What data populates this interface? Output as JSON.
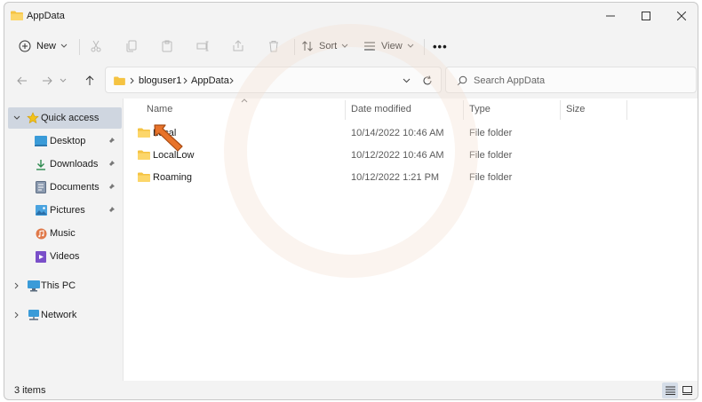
{
  "window": {
    "title": "AppData",
    "controls": {
      "minimize": "—",
      "maximize": "☐",
      "close": "✕"
    }
  },
  "toolbar": {
    "new_label": "New",
    "sort_label": "Sort",
    "view_label": "View",
    "more_label": "•••",
    "icons": [
      "cut-icon",
      "copy-icon",
      "paste-icon",
      "rename-icon",
      "share-icon",
      "delete-icon"
    ]
  },
  "address": {
    "crumbs": [
      "bloguser1",
      "AppData"
    ],
    "separator": ">"
  },
  "search": {
    "placeholder": "Search AppData"
  },
  "navpane": {
    "quick_access": "Quick access",
    "items": [
      {
        "label": "Desktop",
        "icon": "desktop-icon",
        "pinned": true
      },
      {
        "label": "Downloads",
        "icon": "downloads-icon",
        "pinned": true
      },
      {
        "label": "Documents",
        "icon": "documents-icon",
        "pinned": true
      },
      {
        "label": "Pictures",
        "icon": "pictures-icon",
        "pinned": true
      },
      {
        "label": "Music",
        "icon": "music-icon",
        "pinned": false
      },
      {
        "label": "Videos",
        "icon": "videos-icon",
        "pinned": false
      }
    ],
    "this_pc": "This PC",
    "network": "Network"
  },
  "columns": {
    "name": "Name",
    "date": "Date modified",
    "type": "Type",
    "size": "Size"
  },
  "files": [
    {
      "name": "Local",
      "date": "10/14/2022 10:46 AM",
      "type": "File folder"
    },
    {
      "name": "LocalLow",
      "date": "10/12/2022 10:46 AM",
      "type": "File folder"
    },
    {
      "name": "Roaming",
      "date": "10/12/2022 1:21 PM",
      "type": "File folder"
    }
  ],
  "status": {
    "count": "3 items"
  },
  "colors": {
    "folder": "#f5c342",
    "selection": "#cfd6e0",
    "accent": "#0067c0",
    "arrow": "#e8732a"
  }
}
